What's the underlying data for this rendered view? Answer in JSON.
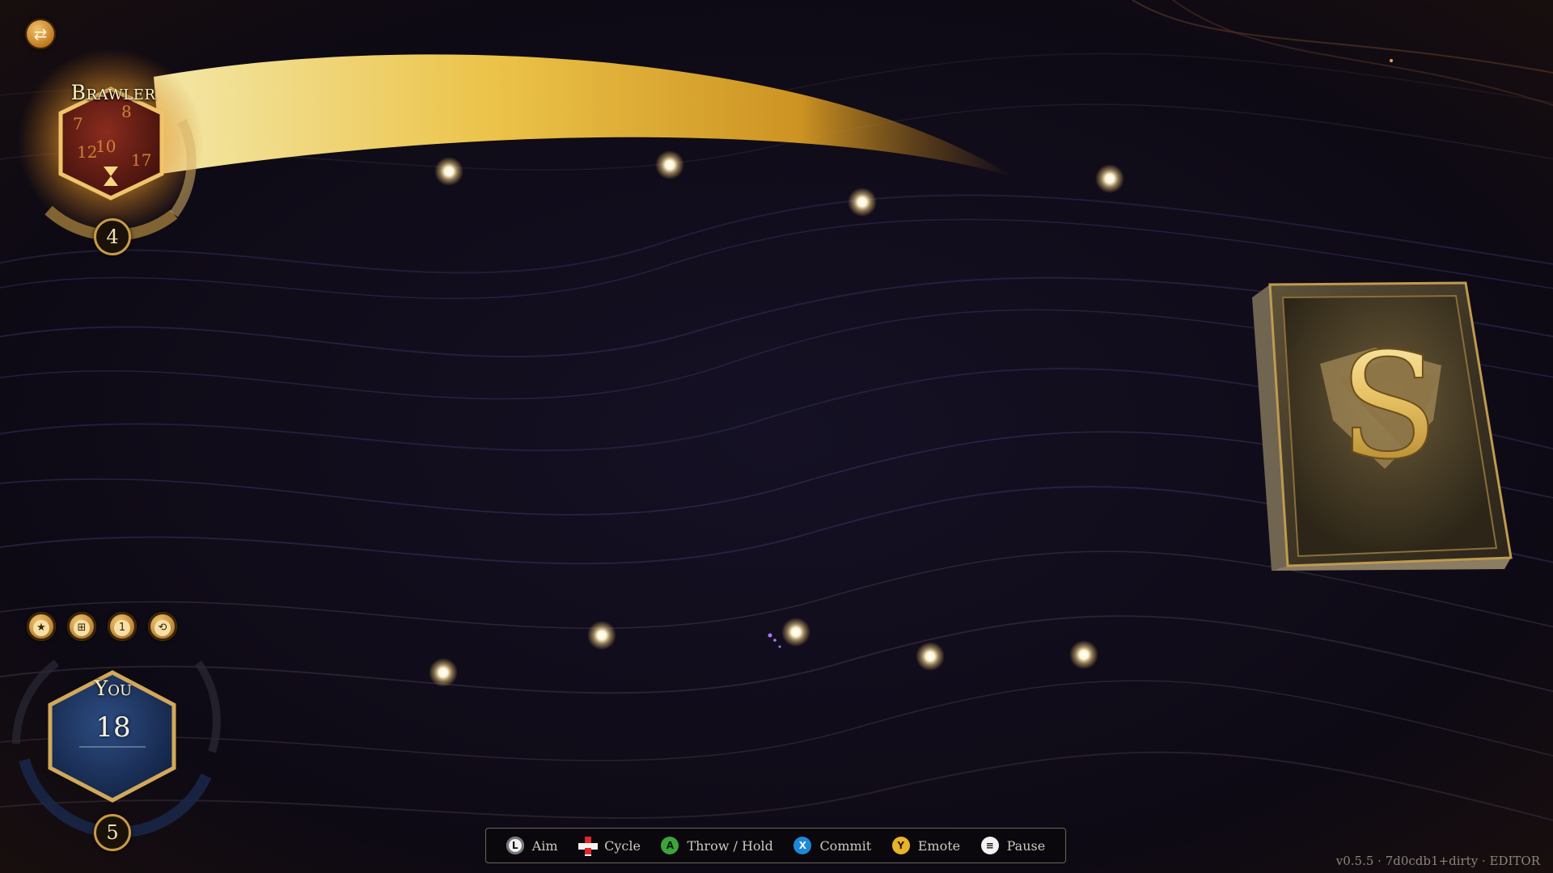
{
  "opponent": {
    "name": "Brawler",
    "dice_count": "4",
    "swap_icon": "⇄"
  },
  "player": {
    "name": "You",
    "hp": "18",
    "dice_count": "5",
    "quick_buttons": [
      {
        "icon": "star-icon",
        "glyph": "★"
      },
      {
        "icon": "grid-icon",
        "glyph": "⊞"
      },
      {
        "icon": "info-icon",
        "glyph": "1"
      },
      {
        "icon": "undo-icon",
        "glyph": "⟲"
      }
    ]
  },
  "deck": {
    "letter": "S"
  },
  "controls": [
    {
      "icon": "left-stick-icon",
      "glyph": "L",
      "label": "Aim"
    },
    {
      "icon": "dpad-icon",
      "glyph": "",
      "label": "Cycle"
    },
    {
      "icon": "a-button-icon",
      "glyph": "A",
      "label": "Throw / Hold"
    },
    {
      "icon": "x-button-icon",
      "glyph": "X",
      "label": "Commit"
    },
    {
      "icon": "y-button-icon",
      "glyph": "Y",
      "label": "Emote"
    },
    {
      "icon": "menu-button-icon",
      "glyph": "≡",
      "label": "Pause"
    }
  ],
  "version": "v0.5.5 · 7d0cdb1+dirty · EDITOR",
  "colors": {
    "gold": "#e9b84a",
    "opponent_die": "#5a1a12",
    "player_die": "#1d3560",
    "a_button": "#3fa33b",
    "x_button": "#1e88d6",
    "y_button": "#e7b32b"
  }
}
